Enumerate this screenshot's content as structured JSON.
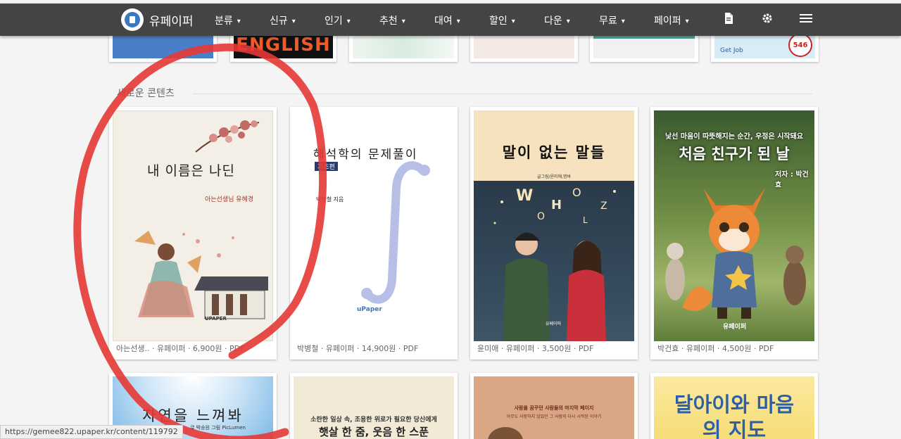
{
  "nav": {
    "brand": "유페이퍼",
    "menu": [
      "분류",
      "신규",
      "인기",
      "추천",
      "대여",
      "할인",
      "다운",
      "무료",
      "페이퍼"
    ],
    "chevron": "⌄",
    "icons": [
      "document-icon",
      "gear-icon",
      "hamburger-menu-icon"
    ]
  },
  "top_row": {
    "english_cover_text": "ENGLISH",
    "getjob_text": "Get Job",
    "badge_text": "546"
  },
  "section": {
    "heading": "새로운 콘텐츠"
  },
  "books": [
    {
      "cover_title": "내 이름은 나딘",
      "cover_author": "아는선생님 유혜경",
      "cover_publisher": "UPAPER",
      "meta": "아는선생.. · 유페이퍼 · 6,900원 · PDF"
    },
    {
      "cover_title": "해석학의 문제풀이",
      "cover_subtitle": "기초편",
      "cover_author": "박병철 지음",
      "cover_publisher": "uPaper",
      "meta": "박병철 · 유페이퍼 · 14,900원 · PDF"
    },
    {
      "cover_title": "말이 없는 말들",
      "cover_author": "글그림/윤미애,명바",
      "cover_publisher": "유페이퍼",
      "meta": "윤미애 · 유페이퍼 · 3,500원 · PDF"
    },
    {
      "cover_tagline": "낯선 마음이 따뜻해지는 순간, 우정은 시작돼요",
      "cover_title": "처음 친구가 된 날",
      "cover_author": "저자 : 박건효",
      "cover_publisher": "유페이퍼",
      "meta": "박건효 · 유페이퍼 · 4,500원 · PDF"
    }
  ],
  "bottom_row": [
    {
      "cover_title": "자연을 느껴봐",
      "cover_author": "글 박승원 그림 PicLumen"
    },
    {
      "cover_tagline": "소란한 일상 속, 조용한 위로가 필요한 당신에게",
      "cover_title": "햇살 한 줌, 웃음 한 스푼"
    },
    {
      "cover_tagline": "사람을 꿈꾸던 사람들의 마지막 페이지",
      "cover_subtitle": "아무도 사랑하지 않았던 그 사람의 다시 시작된 이야기"
    },
    {
      "cover_title": "달아이와 마음의 지도"
    }
  ],
  "status_url": "https://gemee822.upaper.kr/content/119792",
  "colors": {
    "navbar": "#444444",
    "annotation_red": "#e53935",
    "accent_blue": "#3a78c6"
  }
}
